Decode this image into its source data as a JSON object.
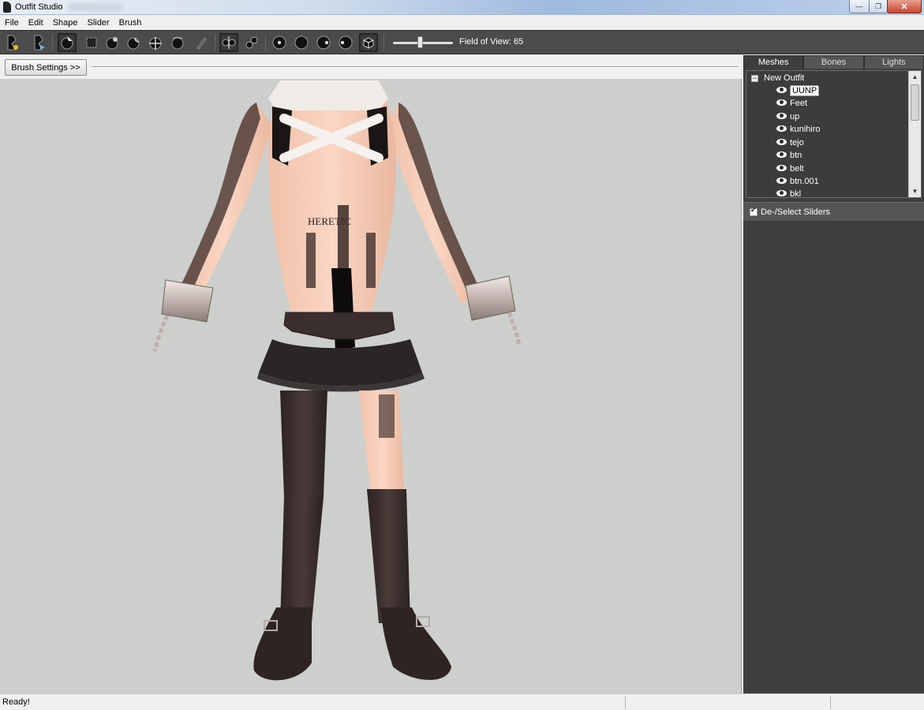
{
  "window": {
    "title": "Outfit Studio",
    "controls": {
      "minimize": "—",
      "maximize": "❐",
      "close": "✕"
    }
  },
  "menu": {
    "items": [
      "File",
      "Edit",
      "Shape",
      "Slider",
      "Brush"
    ]
  },
  "toolbar": {
    "tools": [
      {
        "name": "load-outfit-icon",
        "active": false
      },
      {
        "name": "load-reference-icon",
        "active": false
      },
      {
        "name": "select-brush-icon",
        "active": true
      },
      {
        "name": "mask-brush-icon",
        "active": false
      },
      {
        "name": "inflate-brush-icon",
        "active": false
      },
      {
        "name": "deflate-brush-icon",
        "active": false
      },
      {
        "name": "move-brush-icon",
        "active": false
      },
      {
        "name": "smooth-brush-icon",
        "active": false
      },
      {
        "name": "weight-brush-icon",
        "active": false
      },
      {
        "name": "x-mirror-icon",
        "active": true
      },
      {
        "name": "connected-only-icon",
        "active": false
      },
      {
        "name": "view-front-icon",
        "active": false
      },
      {
        "name": "view-back-icon",
        "active": false
      },
      {
        "name": "view-left-icon",
        "active": false
      },
      {
        "name": "view-right-icon",
        "active": false
      },
      {
        "name": "perspective-icon",
        "active": true
      }
    ],
    "fov_label": "Field of View: 65",
    "fov_value": 65
  },
  "viewport": {
    "brush_settings_label": "Brush Settings >>"
  },
  "panel": {
    "tabs": [
      {
        "label": "Meshes",
        "active": true
      },
      {
        "label": "Bones",
        "active": false
      },
      {
        "label": "Lights",
        "active": false
      }
    ],
    "tree": {
      "root_label": "New Outfit",
      "root_expander": "−",
      "meshes": [
        {
          "label": "UUNP",
          "selected": true
        },
        {
          "label": "Feet",
          "selected": false
        },
        {
          "label": "up",
          "selected": false
        },
        {
          "label": "kunihiro",
          "selected": false
        },
        {
          "label": "tejo",
          "selected": false
        },
        {
          "label": "btn",
          "selected": false
        },
        {
          "label": "belt",
          "selected": false
        },
        {
          "label": "btn.001",
          "selected": false
        },
        {
          "label": "bkl",
          "selected": false
        }
      ]
    },
    "sliders_header": "De-/Select Sliders"
  },
  "status": {
    "text": "Ready!"
  },
  "colors": {
    "toolbar_bg": "#4b4b4b",
    "panel_bg": "#3e3e3e",
    "viewport_bg": "#cdcfcd"
  }
}
